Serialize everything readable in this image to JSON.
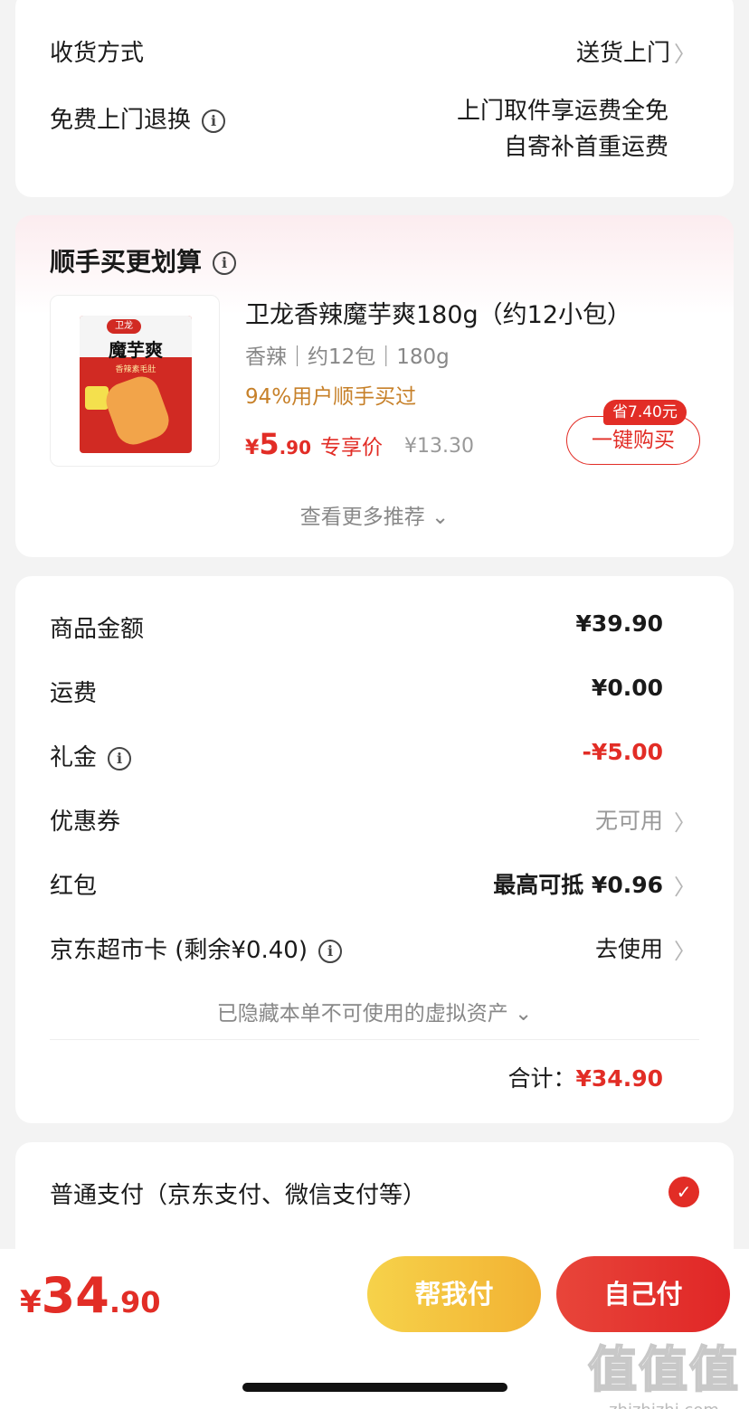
{
  "delivery": {
    "method_label": "收货方式",
    "method_value": "送货上门",
    "return_label": "免费上门退换",
    "return_value_line1": "上门取件享运费全免",
    "return_value_line2": "自寄补首重运费"
  },
  "addon": {
    "title": "顺手买更划算",
    "product": {
      "name": "卫龙香辣魔芋爽180g（约12小包）",
      "spec": "香辣｜约12包｜180g",
      "buyers": "94%用户顺手买过",
      "price_currency": "¥",
      "price_int": "5",
      "price_dec": ".90",
      "price_tag": "专享价",
      "original_price": "¥13.30",
      "save_badge": "省7.40元",
      "buy_button": "一键购买",
      "image_text": {
        "brand": "卫龙",
        "name": "魔芋爽",
        "sub": "香辣素毛肚"
      }
    },
    "more_label": "查看更多推荐"
  },
  "summary": {
    "rows": [
      {
        "label": "商品金额",
        "value": "¥39.90"
      },
      {
        "label": "运费",
        "value": "¥0.00"
      },
      {
        "label": "礼金",
        "value": "-¥5.00"
      },
      {
        "label": "优惠券",
        "value": "无可用"
      },
      {
        "label": "红包",
        "value": "最高可抵 ¥0.96"
      },
      {
        "label": "京东超市卡 (剩余¥0.40)",
        "value": "去使用"
      }
    ],
    "hidden_assets": "已隐藏本单不可使用的虚拟资产",
    "total_label": "合计：",
    "total_value": "¥34.90"
  },
  "payment": {
    "option_label": "普通支付（京东支付、微信支付等）",
    "selected": true
  },
  "bottom": {
    "currency": "¥",
    "amount_int": "34",
    "amount_dec": ".90",
    "help_pay": "帮我付",
    "self_pay": "自己付"
  },
  "watermark": {
    "big": "值值值",
    "small": "zhizhizhi.com"
  },
  "colors": {
    "accent_red": "#e22d26",
    "gold": "#c7812a",
    "help_button": "#f6d24a"
  },
  "icons": [
    "info-icon",
    "chevron-right-icon",
    "chevron-down-icon",
    "checkmark-icon"
  ]
}
